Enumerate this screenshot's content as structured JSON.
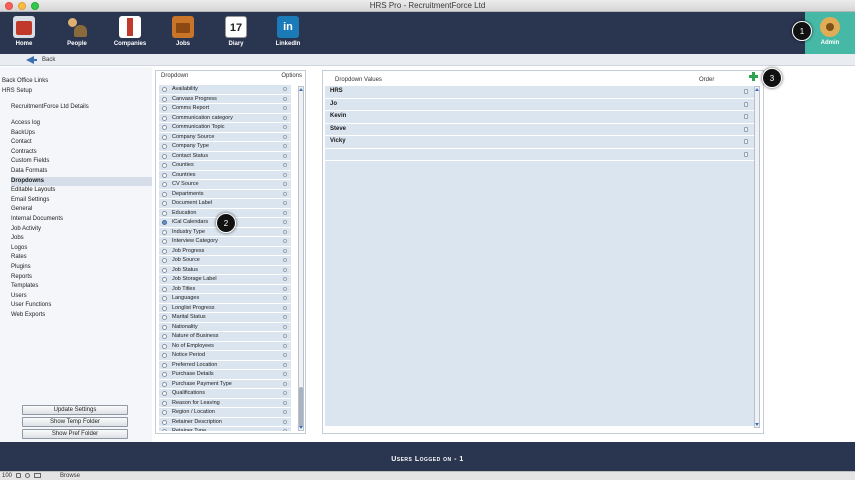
{
  "window": {
    "title": "HRS Pro - RecruitmentForce Ltd"
  },
  "toolbar": {
    "items": [
      {
        "label": "Home",
        "icon": "home-icon"
      },
      {
        "label": "People",
        "icon": "people-icon"
      },
      {
        "label": "Companies",
        "icon": "companies-icon"
      },
      {
        "label": "Jobs",
        "icon": "jobs-icon"
      },
      {
        "label": "Diary",
        "icon": "diary-icon",
        "icon_text": "17"
      },
      {
        "label": "LinkedIn",
        "icon": "linkedin-icon",
        "icon_text": "in"
      }
    ],
    "admin": {
      "label": "Admin",
      "icon": "admin-gear-icon"
    }
  },
  "backbar": {
    "back_label": "Back"
  },
  "sidebar": {
    "top_links": [
      "Back Office Links",
      "HRS Setup"
    ],
    "company": "RecruitmentForce Ltd Details",
    "items": [
      "Access log",
      "BackUps",
      "Contact",
      "Contracts",
      "Custom Fields",
      "Data Formats",
      "Dropdowns",
      "Editable Layouts",
      "Email Settings",
      "General",
      "Internal Documents",
      "Job Activity",
      "Jobs",
      "Logos",
      "Rates",
      "Plugins",
      "Reports",
      "Templates",
      "Users",
      "User Functions",
      "Web Exports"
    ],
    "active_item": "Dropdowns",
    "buttons": [
      "Update Settings",
      "Show Temp Folder",
      "Show Pref Folder"
    ]
  },
  "dropdown_panel": {
    "header_left": "Dropdown",
    "header_right": "Options",
    "selected": "iCal Calendars",
    "items": [
      "Availability",
      "Canvass Progress",
      "Comms Report",
      "Communication category",
      "Communication Topic",
      "Company Source",
      "Company Type",
      "Contact Status",
      "Counties",
      "Countries",
      "CV Source",
      "Departments",
      "Document Label",
      "Education",
      "iCal Calendars",
      "Industry Type",
      "Interview Category",
      "Job Progress",
      "Job Source",
      "Job Status",
      "Job Storage Label",
      "Job Titles",
      "Languages",
      "Longlist Progress",
      "Marital Status",
      "Nationality",
      "Nature of Business",
      "No of Employees",
      "Notice Period",
      "Preferred Location",
      "Purchase Details",
      "Purchase Payment Type",
      "Qualifications",
      "Reason for Leaving",
      "Region / Location",
      "Retainer Description",
      "Retainer Type"
    ]
  },
  "values_panel": {
    "header_left": "Dropdown Values",
    "header_right": "Order",
    "rows": [
      "HRS",
      "Jo",
      "Kevin",
      "Steve",
      "Vicky",
      ""
    ]
  },
  "callouts": [
    "1",
    "2",
    "3"
  ],
  "footer": {
    "text": "Users Logged on - 1"
  },
  "statusbar": {
    "zoom": "100",
    "mode": "Browse"
  },
  "colors": {
    "toolbar_bg": "#2a3550",
    "admin_accent": "#46b9a6",
    "row_bg": "#dbe5f0",
    "add_green": "#2ea44f"
  }
}
